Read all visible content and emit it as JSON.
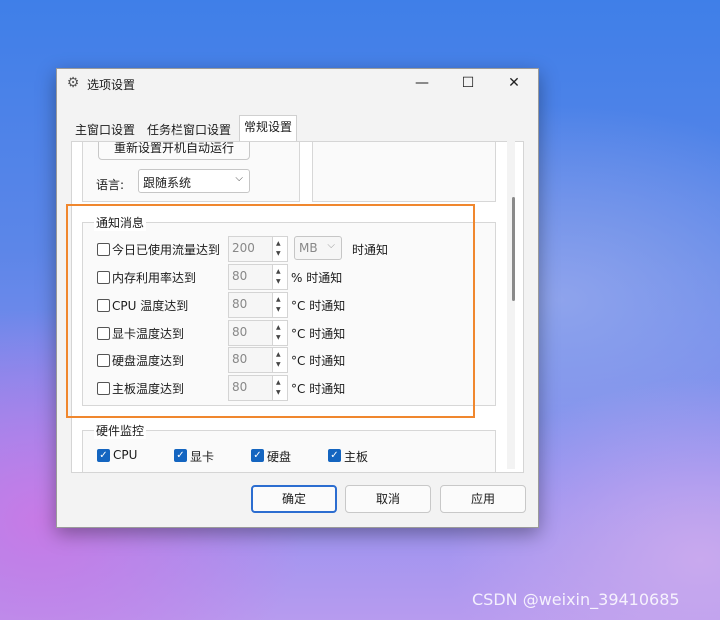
{
  "window": {
    "title": "选项设置",
    "controls": {
      "minimize": "—",
      "maximize": "☐",
      "close": "✕"
    }
  },
  "tabs": [
    {
      "label": "主窗口设置",
      "active": false
    },
    {
      "label": "任务栏窗口设置",
      "active": false
    },
    {
      "label": "常规设置",
      "active": true
    }
  ],
  "general": {
    "reset_autorun_button": "重新设置开机自动运行",
    "language_label": "语言:",
    "language_value": "跟随系统"
  },
  "notifications": {
    "group_title": "通知消息",
    "rows": [
      {
        "label": "今日已使用流量达到",
        "value": "200",
        "unit_select": "MB",
        "suffix": "时通知",
        "checked": false
      },
      {
        "label": "内存利用率达到",
        "value": "80",
        "suffix": "% 时通知",
        "checked": false
      },
      {
        "label": "CPU 温度达到",
        "value": "80",
        "suffix": "°C 时通知",
        "checked": false
      },
      {
        "label": "显卡温度达到",
        "value": "80",
        "suffix": "°C 时通知",
        "checked": false
      },
      {
        "label": "硬盘温度达到",
        "value": "80",
        "suffix": "°C 时通知",
        "checked": false
      },
      {
        "label": "主板温度达到",
        "value": "80",
        "suffix": "°C 时通知",
        "checked": false
      }
    ]
  },
  "hardware": {
    "group_title": "硬件监控",
    "items": [
      {
        "label": "CPU",
        "checked": true
      },
      {
        "label": "显卡",
        "checked": true
      },
      {
        "label": "硬盘",
        "checked": true
      },
      {
        "label": "主板",
        "checked": true
      }
    ]
  },
  "footer": {
    "ok": "确定",
    "cancel": "取消",
    "apply": "应用"
  },
  "watermark": "CSDN @weixin_39410685",
  "colors": {
    "highlight_border": "#f0872e",
    "accent": "#1465c0"
  }
}
